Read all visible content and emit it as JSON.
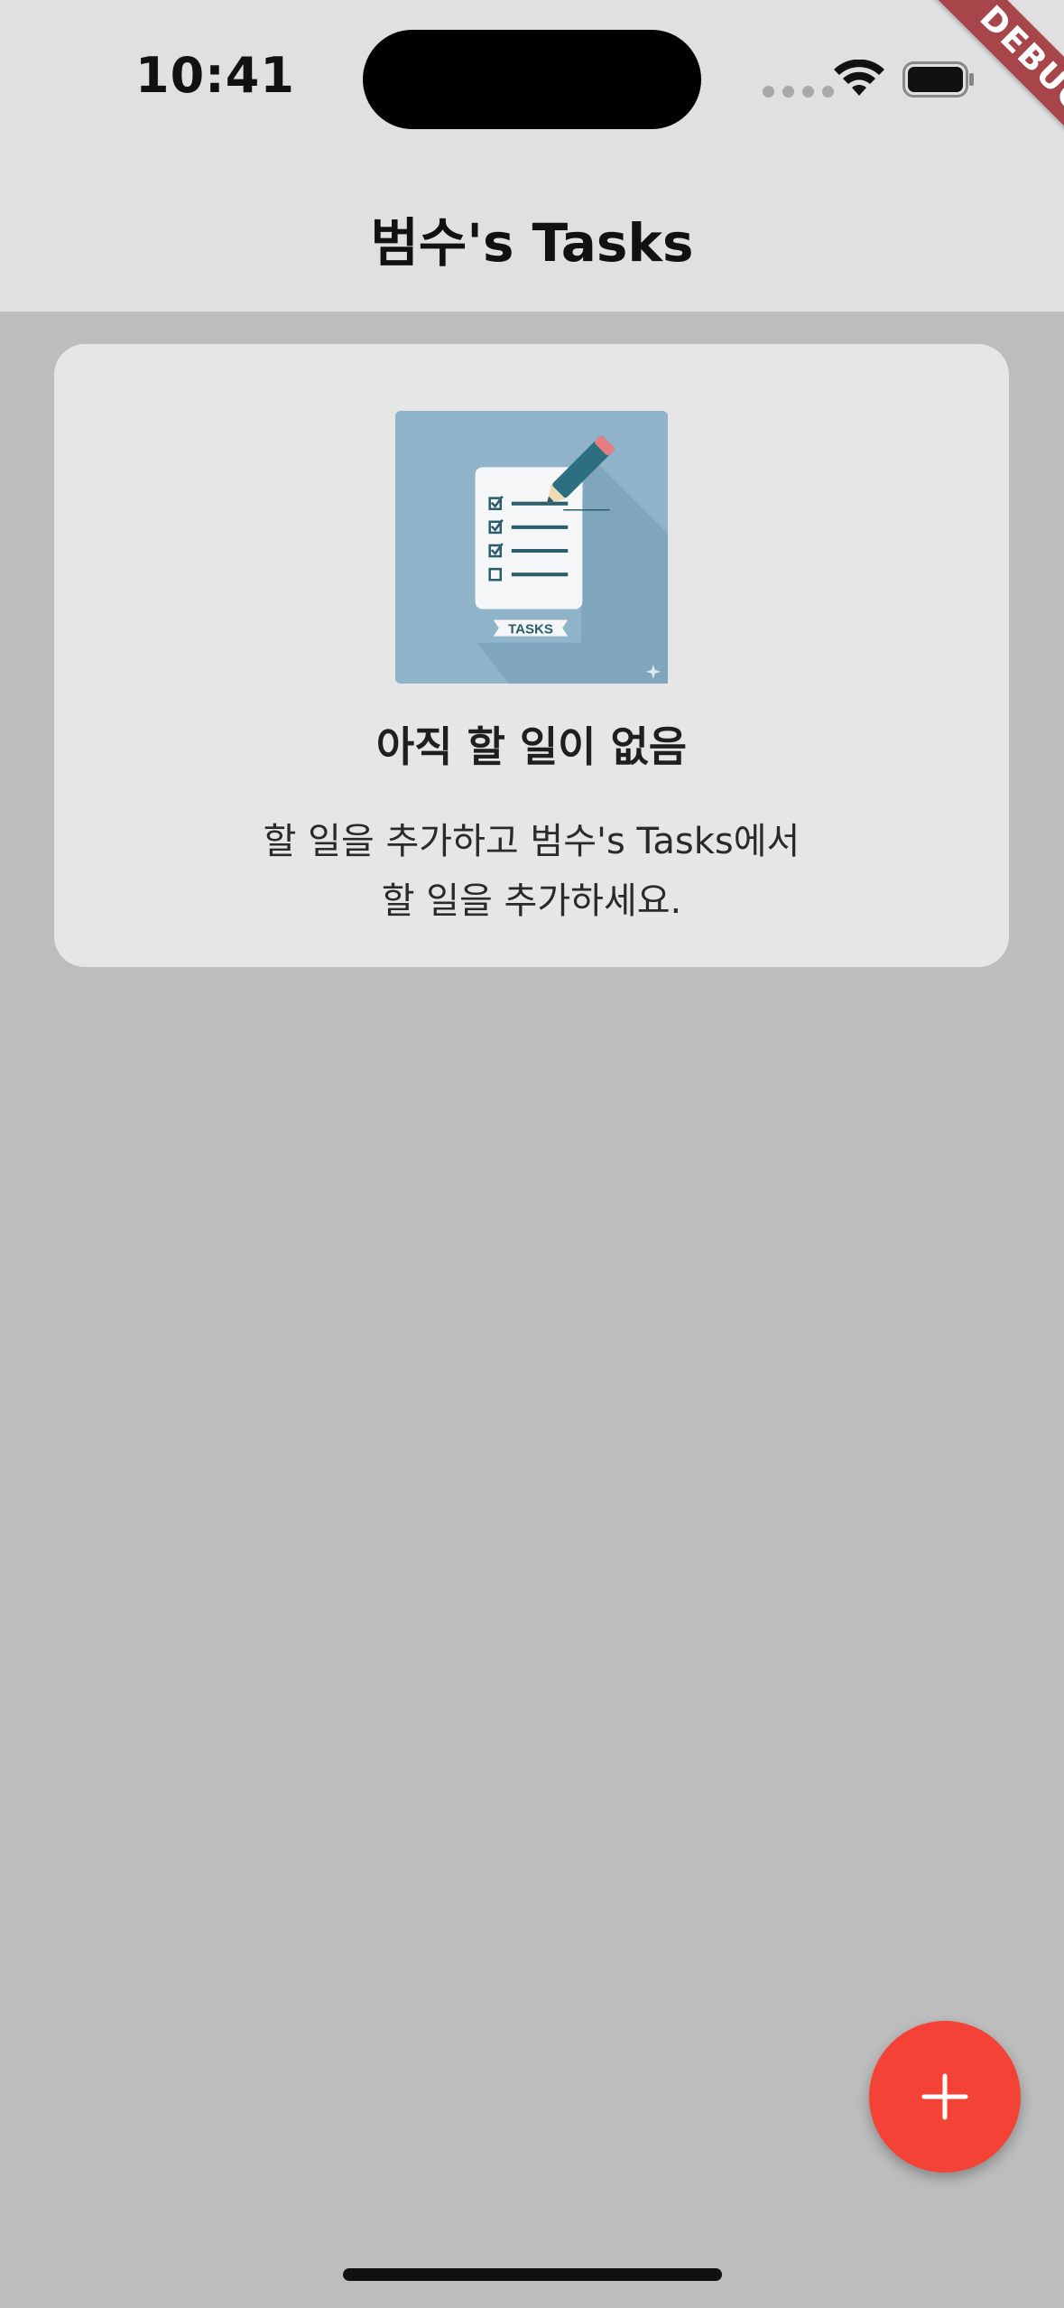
{
  "status_bar": {
    "time": "10:41",
    "wifi_icon": "wifi-icon",
    "battery_icon": "battery-icon"
  },
  "debug_banner": {
    "label": "DEBUG",
    "color": "#a7464a"
  },
  "app_bar": {
    "title": "범수's Tasks"
  },
  "empty_state": {
    "illustration_icon": "tasks-checklist-icon",
    "illustration_label": "TASKS",
    "heading": "아직 할 일이 없음",
    "message_line1": "할 일을 추가하고 범수's Tasks에서",
    "message_line2": "할 일을 추가하세요."
  },
  "fab": {
    "icon": "plus-icon",
    "color": "#f44336"
  },
  "colors": {
    "background": "#bdbdbd",
    "app_bar": "#e0e0e0",
    "card": "#e6e6e6",
    "illustration_bg": "#8fb3c9"
  }
}
